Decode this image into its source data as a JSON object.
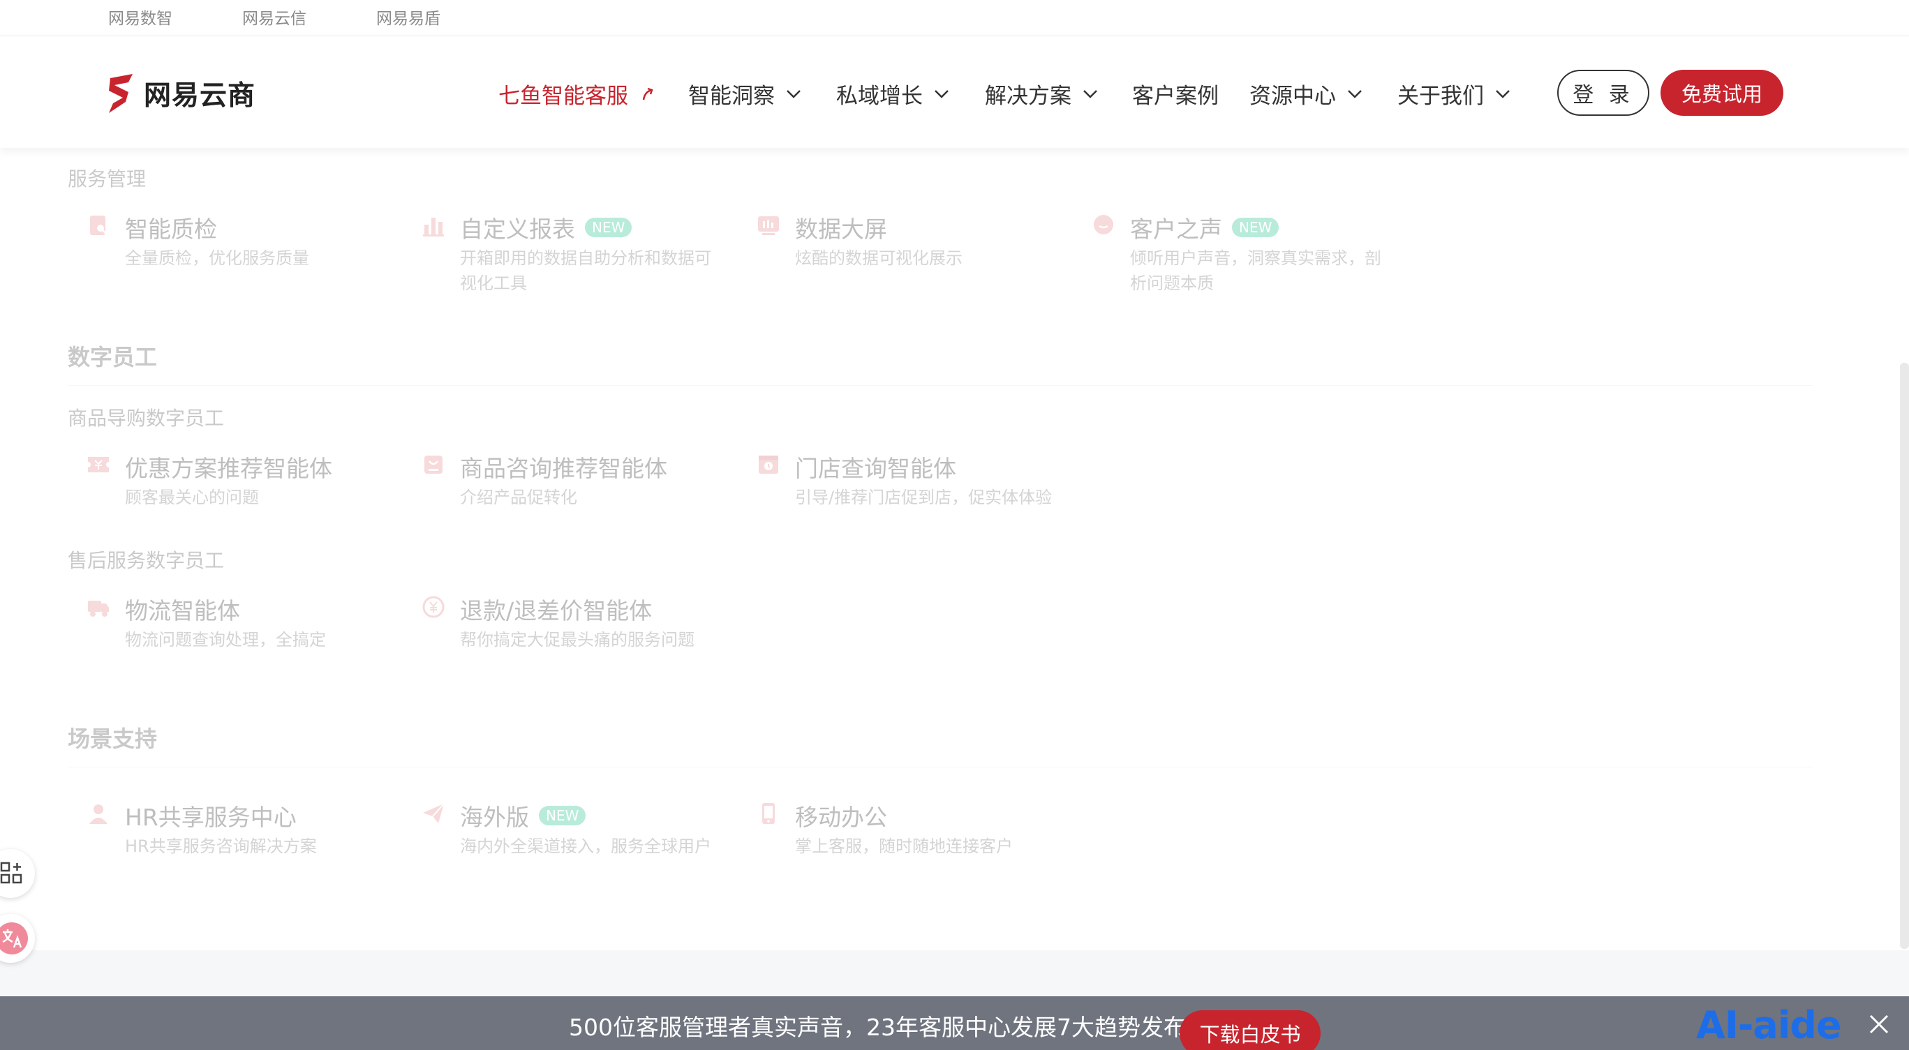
{
  "top_links": [
    "网易数智",
    "网易云信",
    "网易易盾"
  ],
  "brand": {
    "name": "网易云商",
    "accent": "#c8242e"
  },
  "nav": {
    "items": [
      {
        "label": "七鱼智能客服",
        "active": true,
        "icon": "arrow-icon"
      },
      {
        "label": "智能洞察",
        "icon": "chevron-down-icon"
      },
      {
        "label": "私域增长",
        "icon": "chevron-down-icon"
      },
      {
        "label": "解决方案",
        "icon": "chevron-down-icon"
      },
      {
        "label": "客户案例"
      },
      {
        "label": "资源中心",
        "icon": "chevron-down-icon"
      },
      {
        "label": "关于我们",
        "icon": "chevron-down-icon"
      }
    ],
    "login_label": "登 录",
    "trial_label": "免费试用"
  },
  "sections": {
    "service_mgmt": {
      "subheading": "服务管理",
      "items": [
        {
          "title": "智能质检",
          "desc": "全量质检，优化服务质量",
          "icon": "inspection-icon"
        },
        {
          "title": "自定义报表",
          "badge": "NEW",
          "desc_line1": "开箱即用的数据自助分析和数据可",
          "desc_line2": "视化工具",
          "icon": "bar-chart-icon"
        },
        {
          "title": "数据大屏",
          "desc": "炫酷的数据可视化展示",
          "icon": "dashboard-icon"
        },
        {
          "title": "客户之声",
          "badge": "NEW",
          "desc_line1": "倾听用户声音，洞察真实需求，剖",
          "desc_line2": "析问题本质",
          "icon": "chat-bubble-icon"
        }
      ]
    },
    "digital_staff": {
      "title": "数字员工",
      "groups": [
        {
          "subheading": "商品导购数字员工",
          "items": [
            {
              "title": "优惠方案推荐智能体",
              "desc": "顾客最关心的问题",
              "icon": "coupon-icon"
            },
            {
              "title": "商品咨询推荐智能体",
              "desc": "介绍产品促转化",
              "icon": "shopping-bag-icon"
            },
            {
              "title": "门店查询智能体",
              "desc": "引导/推荐门店促到店，促实体体验",
              "icon": "store-icon"
            }
          ]
        },
        {
          "subheading": "售后服务数字员工",
          "items": [
            {
              "title": "物流智能体",
              "desc": "物流问题查询处理，全搞定",
              "icon": "truck-icon"
            },
            {
              "title": "退款/退差价智能体",
              "desc": "帮你搞定大促最头痛的服务问题",
              "icon": "yuan-refund-icon"
            }
          ]
        }
      ]
    },
    "scenario": {
      "title": "场景支持",
      "items": [
        {
          "title": "HR共享服务中心",
          "desc": "HR共享服务咨询解决方案",
          "icon": "person-icon"
        },
        {
          "title": "海外版",
          "badge": "NEW",
          "desc": "海内外全渠道接入，服务全球用户",
          "icon": "paper-plane-icon"
        },
        {
          "title": "移动办公",
          "desc": "掌上客服，随时随地连接客户",
          "icon": "mobile-icon"
        }
      ]
    }
  },
  "banner": {
    "text": "500位客服管理者真实声音，23年客服中心发展7大趋势发布",
    "button_label": "下载白皮书",
    "watermark": "AI-aide"
  }
}
